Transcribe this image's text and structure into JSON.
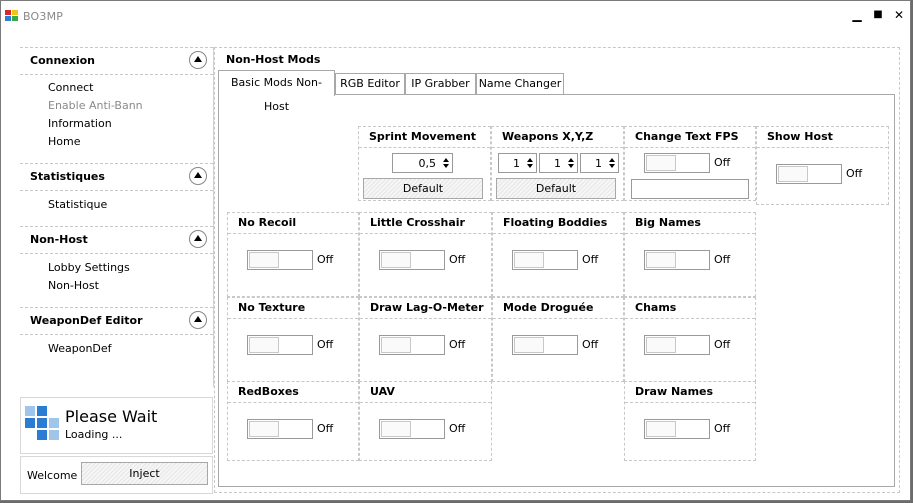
{
  "window": {
    "title": "BO3MP",
    "minimize": "▁",
    "maximize": "■",
    "close": "✕"
  },
  "sidebar": {
    "sections": [
      {
        "title": "Connexion",
        "items": [
          "Connect",
          "Enable Anti-Bann",
          "Information",
          "Home"
        ]
      },
      {
        "title": "Statistiques",
        "items": [
          "Statistique"
        ]
      },
      {
        "title": "Non-Host",
        "items": [
          "Lobby Settings",
          "Non-Host"
        ]
      },
      {
        "title": "WeaponDef Editor",
        "items": [
          "WeaponDef"
        ]
      }
    ]
  },
  "status": {
    "title": "Please Wait",
    "subtitle": "Loading ..."
  },
  "welcome": {
    "label": "Welcome :",
    "inject": "Inject"
  },
  "panel": {
    "header": "Non-Host Mods",
    "tabs": [
      "Basic Mods Non-Host",
      "RGB Editor",
      "IP Grabber",
      "Name Changer"
    ]
  },
  "mods": {
    "sprint_movement": {
      "title": "Sprint Movement",
      "value": "0,5",
      "default": "Default"
    },
    "weapons_xyz": {
      "title": "Weapons X,Y,Z",
      "x": "1",
      "y": "1",
      "z": "1",
      "default": "Default"
    },
    "change_text_fps": {
      "title": "Change Text FPS",
      "state": "Off",
      "text": ""
    },
    "show_host": {
      "title": "Show Host",
      "state": "Off"
    },
    "no_recoil": {
      "title": "No Recoil",
      "state": "Off"
    },
    "little_crosshair": {
      "title": "Little Crosshair",
      "state": "Off"
    },
    "floating_bodies": {
      "title": "Floating Boddies",
      "state": "Off"
    },
    "big_names": {
      "title": "Big Names",
      "state": "Off"
    },
    "no_texture": {
      "title": "No Texture",
      "state": "Off"
    },
    "draw_lag_o_meter": {
      "title": "Draw Lag-O-Meter",
      "state": "Off"
    },
    "mode_droguee": {
      "title": "Mode Droguée",
      "state": "Off"
    },
    "chams": {
      "title": "Chams",
      "state": "Off"
    },
    "redboxes": {
      "title": "RedBoxes",
      "state": "Off"
    },
    "uav": {
      "title": "UAV",
      "state": "Off"
    },
    "draw_names": {
      "title": "Draw Names",
      "state": "Off"
    }
  }
}
